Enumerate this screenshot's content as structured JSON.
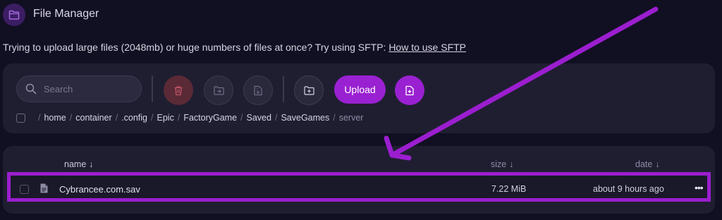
{
  "header": {
    "title": "File Manager",
    "icon": "folder-icon"
  },
  "notice": {
    "text": "Trying to upload large files (2048mb) or huge numbers of files at once? Try using SFTP: ",
    "link": "How to use SFTP"
  },
  "toolbar": {
    "search_placeholder": "Search",
    "upload_label": "Upload",
    "icons": [
      "trash-icon",
      "move-folder-icon",
      "archive-file-icon",
      "new-folder-icon",
      "new-file-icon"
    ]
  },
  "breadcrumb": {
    "items": [
      "home",
      "container",
      ".config",
      "Epic",
      "FactoryGame",
      "Saved",
      "SaveGames"
    ],
    "current": "server"
  },
  "table": {
    "columns": {
      "name": "name",
      "size": "size",
      "date": "date"
    },
    "sort_arrow": "↓",
    "rows": [
      {
        "name": "Cybrancee.com.sav",
        "size": "7.22 MiB",
        "date": "about 9 hours ago",
        "actions": "•••"
      }
    ]
  },
  "colors": {
    "accent": "#9a21d1",
    "annotation": "#9b1ecf",
    "panel": "#1f1e31",
    "background": "#110f22"
  }
}
